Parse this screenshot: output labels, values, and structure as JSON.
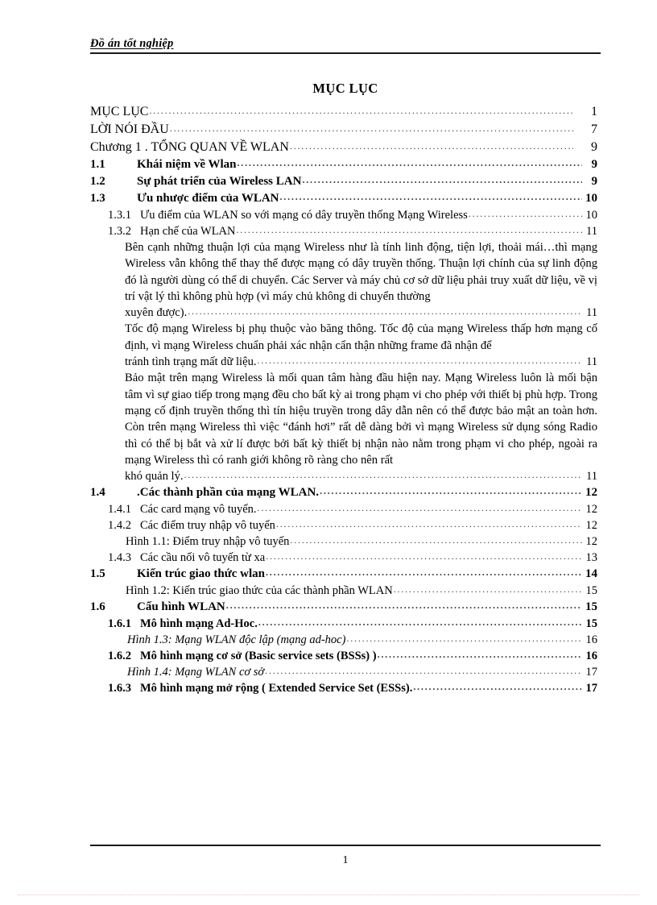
{
  "header": {
    "running_title": "Đồ án tốt nghiệp"
  },
  "document": {
    "title": "MỤC LỤC"
  },
  "toc": {
    "top_entries": [
      {
        "label": "MỤC LỤC",
        "page": "1"
      },
      {
        "label": "LỜI NÓI ĐẦU",
        "page": "7"
      },
      {
        "label": "Chương 1 . TỔNG QUAN VỀ WLAN",
        "page": "9"
      }
    ],
    "entries": [
      {
        "num": "1.1",
        "label": "Khái niệm về Wlan",
        "page": "9"
      },
      {
        "num": "1.2",
        "label": "Sự phát triển của Wireless LAN",
        "page": "9"
      },
      {
        "num": "1.3",
        "label": "Ưu nhược điểm của WLAN",
        "page": "10"
      },
      {
        "num": "1.3.1",
        "label": "Ưu điểm của WLAN so với mạng có dây truyền thống Mạng Wireless",
        "page": "10"
      },
      {
        "num": "1.3.2",
        "label": "Hạn chế của WLAN",
        "page": "11"
      },
      {
        "num": "1.4",
        "label": ".Các thành phần của mạng WLAN.",
        "page": "12"
      },
      {
        "num": "1.4.1",
        "label": "Các card mạng vô tuyến.",
        "page": "12"
      },
      {
        "num": "1.4.2",
        "label": "Các điểm truy nhập vô tuyến",
        "page": "12"
      },
      {
        "num": "",
        "label": "Hình 1.1: Điểm truy nhập vô tuyến",
        "page": "12"
      },
      {
        "num": "1.4.3",
        "label": "Các cầu nối vô tuyến từ xa",
        "page": "13"
      },
      {
        "num": "1.5",
        "label": "Kiến trúc giao thức wlan",
        "page": "14"
      },
      {
        "num": "",
        "label": "Hình 1.2: Kiến trúc giao thức của các thành phần WLAN",
        "page": "15"
      },
      {
        "num": "1.6",
        "label": "Cấu hình WLAN",
        "page": "15"
      },
      {
        "num": "1.6.1",
        "label": "Mô hình mạng Ad-Hoc.",
        "page": "15"
      },
      {
        "num": "",
        "label": "Hình 1.3: Mạng WLAN độc lập (mạng ad-hoc)",
        "page": "16"
      },
      {
        "num": "1.6.2",
        "label": "Mô hình mạng cơ sở (Basic service sets (BSSs) )",
        "page": "16"
      },
      {
        "num": "",
        "label": "Hình 1.4: Mạng WLAN cơ sở",
        "page": "17"
      },
      {
        "num": "1.6.3",
        "label": "Mô hình mạng mở rộng ( Extended Service Set (ESSs).",
        "page": "17"
      }
    ],
    "paragraphs": [
      {
        "body": "Bên cạnh những thuận lợi của mạng Wireless như là tính linh động, tiện lợi, thoải mái…thì mạng Wireless vẫn không thể thay thế được mạng có dây truyền thống. Thuận lợi chính của sự linh động đó là người dùng có thể di chuyển. Các Server và máy chủ cơ sở dữ liệu phải truy xuất dữ liệu, về vị trí vật lý thì không phù hợp (vì máy chủ không di chuyển thường",
        "tail": "xuyên được).",
        "page": "11"
      },
      {
        "body": "Tốc độ mạng Wireless bị phụ thuộc vào băng thông. Tốc độ của mạng Wireless thấp hơn mạng cố định, vì mạng Wireless chuẩn phải xác nhận cẩn thận những frame đã nhận để",
        "tail": "tránh tình trạng mất dữ liệu.",
        "page": "11"
      },
      {
        "body": "Bảo mật trên mạng Wireless là mối quan tâm hàng đầu hiện nay. Mạng Wireless luôn là mối bận tâm vì sự giao tiếp trong mạng đều cho bất kỳ ai trong phạm vi cho phép với thiết bị phù hợp. Trong mạng cố định truyền thống thì tín hiệu truyền trong dây dẫn nên có thể được bảo mật an toàn hơn. Còn trên mạng Wireless thì việc “đánh hơi” rất dễ dàng bởi vì mạng Wireless sử dụng sóng Radio thì có thể bị bắt và xử lí được bởi bất kỳ thiết bị nhận nào nằm trong phạm vi cho phép, ngoài ra mạng Wireless thì có ranh giới không rõ ràng cho nên rất",
        "tail": "khó quản lý.",
        "page": "11"
      }
    ]
  },
  "footer": {
    "page_number": "1"
  }
}
